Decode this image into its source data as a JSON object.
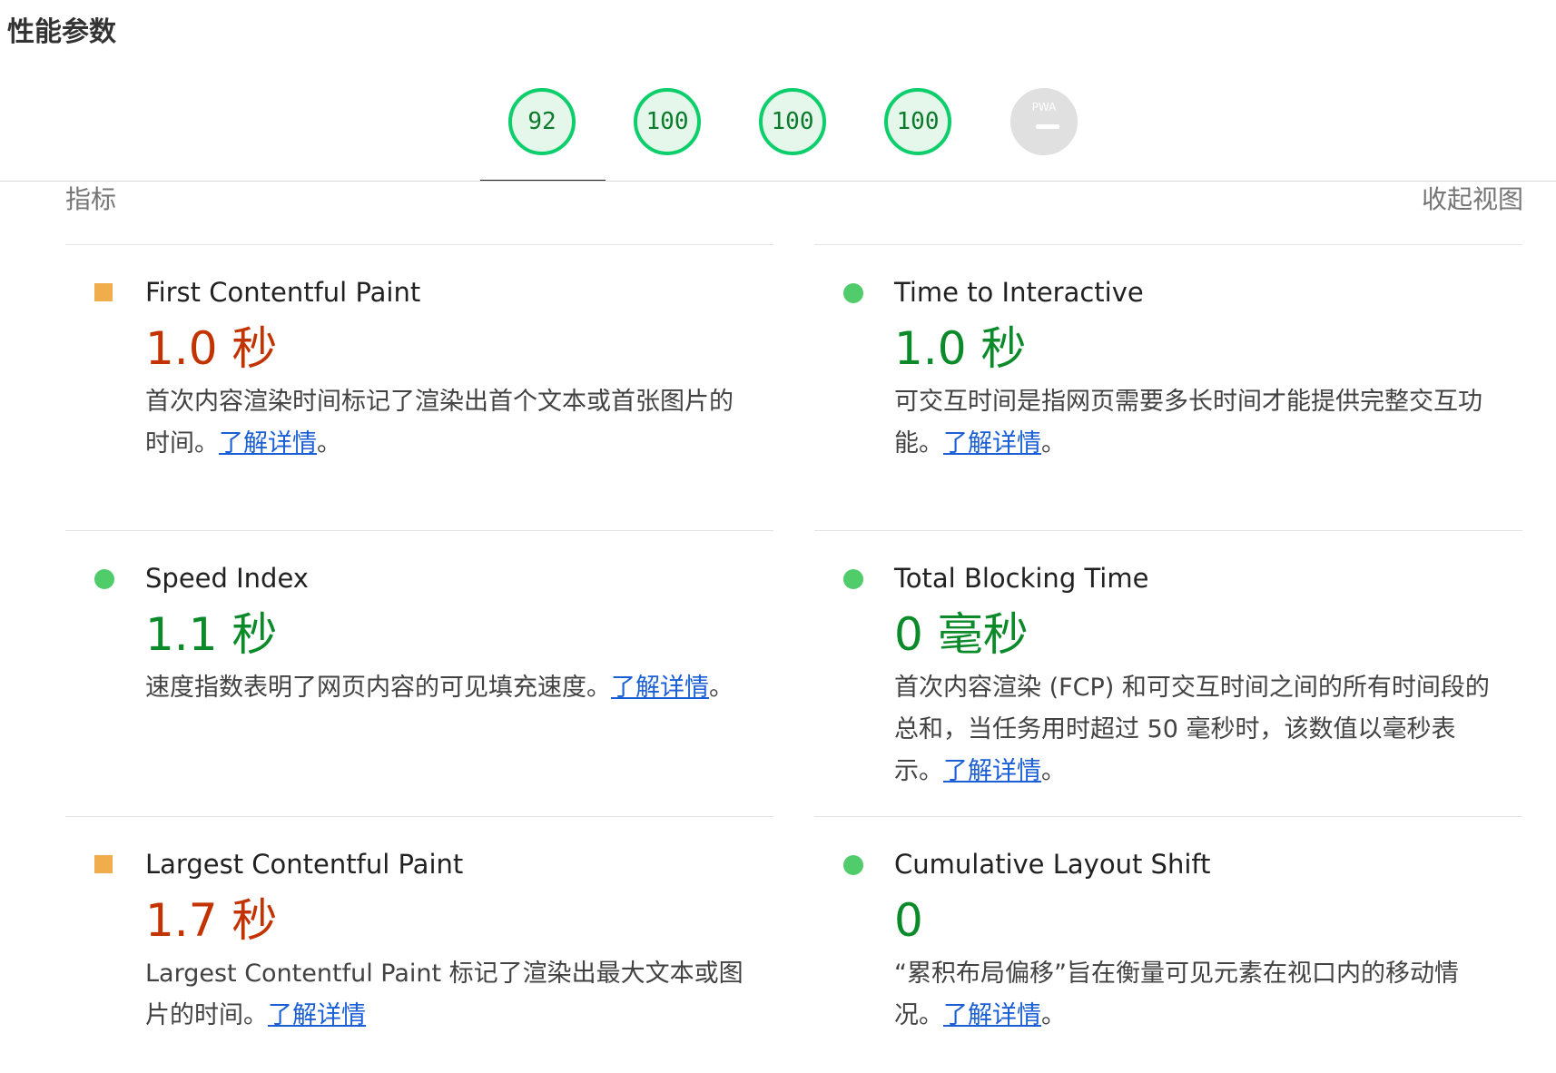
{
  "page_title": "性能参数",
  "gauges": [
    {
      "label": "92",
      "progress": 0.92
    },
    {
      "label": "100",
      "progress": 1.0
    },
    {
      "label": "100",
      "progress": 1.0
    },
    {
      "label": "100",
      "progress": 1.0
    },
    {
      "label": "PWA",
      "progress": null
    }
  ],
  "section": {
    "label": "指标",
    "toggle": "收起视图"
  },
  "metrics": {
    "fcp": {
      "name": "First Contentful Paint",
      "value": "1.0 秒",
      "status": "average",
      "status_color": "#f0ad4e",
      "desc": "首次内容渲染时间标记了渲染出首个文本或首张图片的时间。",
      "link": "了解详情",
      "tail": "。"
    },
    "tti": {
      "name": "Time to Interactive",
      "value": "1.0 秒",
      "status": "pass",
      "status_color": "#51cc6b",
      "desc": "可交互时间是指网页需要多长时间才能提供完整交互功能。",
      "link": "了解详情",
      "tail": "。"
    },
    "si": {
      "name": "Speed Index",
      "value": "1.1 秒",
      "status": "pass",
      "status_color": "#51cc6b",
      "desc": "速度指数表明了网页内容的可见填充速度。",
      "link": "了解详情",
      "tail": "。"
    },
    "tbt": {
      "name": "Total Blocking Time",
      "value": "0 毫秒",
      "status": "pass",
      "status_color": "#51cc6b",
      "desc": "首次内容渲染 (FCP) 和可交互时间之间的所有时间段的总和，当任务用时超过 50 毫秒时，该数值以毫秒表示。",
      "link": "了解详情",
      "tail": "。"
    },
    "lcp": {
      "name": "Largest Contentful Paint",
      "value": "1.7 秒",
      "status": "average",
      "status_color": "#f0ad4e",
      "desc": "Largest Contentful Paint 标记了渲染出最大文本或图片的时间。",
      "link": "了解详情",
      "tail": ""
    },
    "cls": {
      "name": "Cumulative Layout Shift",
      "value": "0",
      "status": "pass",
      "status_color": "#51cc6b",
      "desc": "“累积布局偏移”旨在衡量可见元素在视口内的移动情况。",
      "link": "了解详情",
      "tail": "。"
    }
  }
}
